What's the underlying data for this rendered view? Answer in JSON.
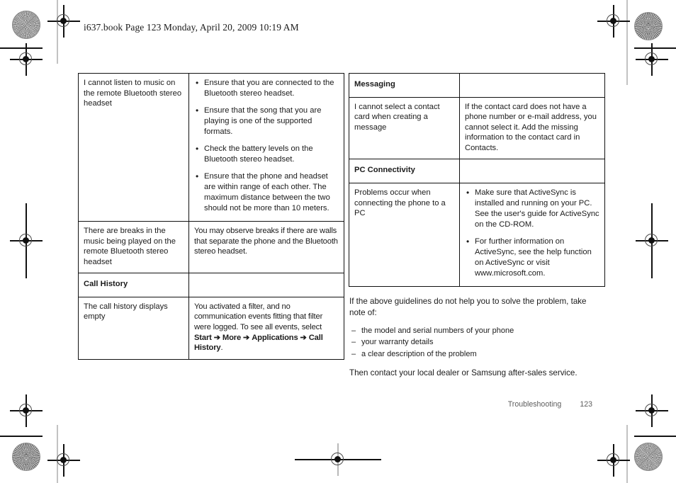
{
  "header": {
    "file_info": "i637.book  Page 123  Monday, April 20, 2009  10:19 AM"
  },
  "left_table": {
    "rows": [
      {
        "type": "content",
        "problem": "I cannot listen to music on the remote Bluetooth stereo headset",
        "solution_bullets": [
          "Ensure that you are connected to the Bluetooth stereo headset.",
          "Ensure that the song that you are playing is one of the supported formats.",
          "Check the battery levels on the Bluetooth stereo headset.",
          "Ensure that the phone and headset are within range of each other. The maximum distance between the two should not be more than 10 meters."
        ]
      },
      {
        "type": "content",
        "problem": "There are breaks in the music being played on the remote Bluetooth stereo headset",
        "solution": "You may observe breaks if there are walls that separate the phone and the Bluetooth stereo headset."
      },
      {
        "type": "header",
        "problem": "Call History",
        "solution": ""
      },
      {
        "type": "content-rich",
        "problem": "The call history displays empty",
        "solution_prefix": "You activated a filter, and no communication events fitting that filter were logged. To see all events, select ",
        "solution_path": [
          "Start",
          "More",
          "Applications",
          "Call History"
        ],
        "solution_suffix": "."
      }
    ]
  },
  "right_table": {
    "rows": [
      {
        "type": "header",
        "problem": "Messaging",
        "solution": ""
      },
      {
        "type": "content",
        "problem": "I cannot select a contact card when creating a message",
        "solution": "If the contact card does not have a phone number or e-mail address, you cannot select it. Add the missing information to the contact card in Contacts."
      },
      {
        "type": "header",
        "problem": "PC Connectivity",
        "solution": ""
      },
      {
        "type": "content",
        "problem": "Problems occur when connecting the phone to a PC",
        "solution_bullets": [
          "Make sure that ActiveSync is installed and running on your PC. See the user's guide for ActiveSync on the CD-ROM.",
          "For further information on ActiveSync, see the help function on ActiveSync or visit www.microsoft.com."
        ]
      }
    ]
  },
  "body": {
    "intro": "If the above guidelines do not help you to solve the problem, take note of:",
    "items": [
      "the model and serial numbers of your phone",
      "your warranty details",
      "a clear description of the problem"
    ],
    "outro": "Then contact your local dealer or Samsung after-sales service."
  },
  "footer": {
    "section": "Troubleshooting",
    "page_number": "123"
  },
  "arrow_glyph": "➔"
}
